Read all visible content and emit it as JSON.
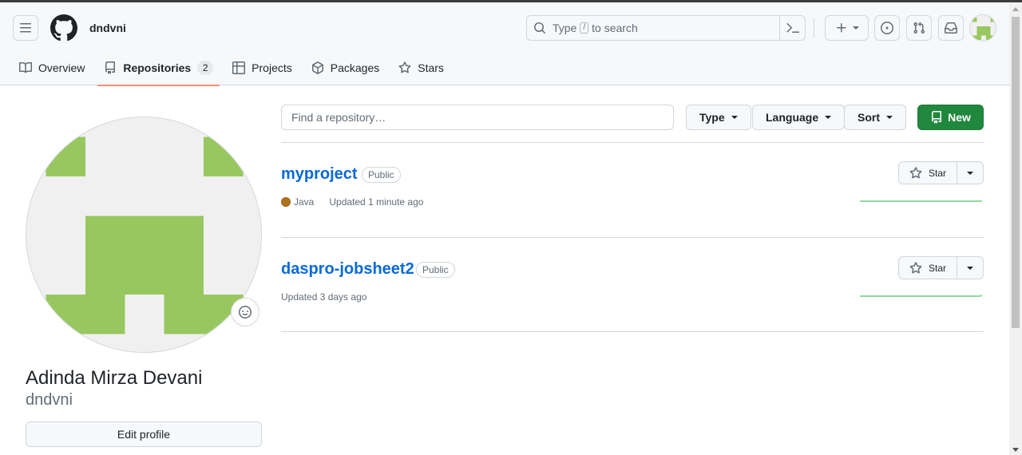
{
  "header": {
    "username": "dndvni",
    "search": {
      "prefix": "Type",
      "slash_key": "/",
      "suffix": "to search"
    }
  },
  "tabs": [
    {
      "label": "Overview"
    },
    {
      "label": "Repositories",
      "count": "2"
    },
    {
      "label": "Projects"
    },
    {
      "label": "Packages"
    },
    {
      "label": "Stars"
    }
  ],
  "profile": {
    "full_name": "Adinda Mirza Devani",
    "login": "dndvni",
    "edit_label": "Edit profile",
    "avatar_color": "#98c760"
  },
  "filters": {
    "find_placeholder": "Find a repository…",
    "type_label": "Type",
    "language_label": "Language",
    "sort_label": "Sort",
    "new_label": "New"
  },
  "repos": [
    {
      "name": "myproject",
      "visibility": "Public",
      "language": "Java",
      "language_color": "#b07219",
      "updated": "Updated 1 minute ago",
      "star_label": "Star"
    },
    {
      "name": "daspro-jobsheet2",
      "visibility": "Public",
      "updated": "Updated 3 days ago",
      "star_label": "Star"
    }
  ],
  "colors": {
    "accent_green": "#1f883d",
    "link_blue": "#0969da",
    "active_tab_underline": "#fd8c73"
  }
}
